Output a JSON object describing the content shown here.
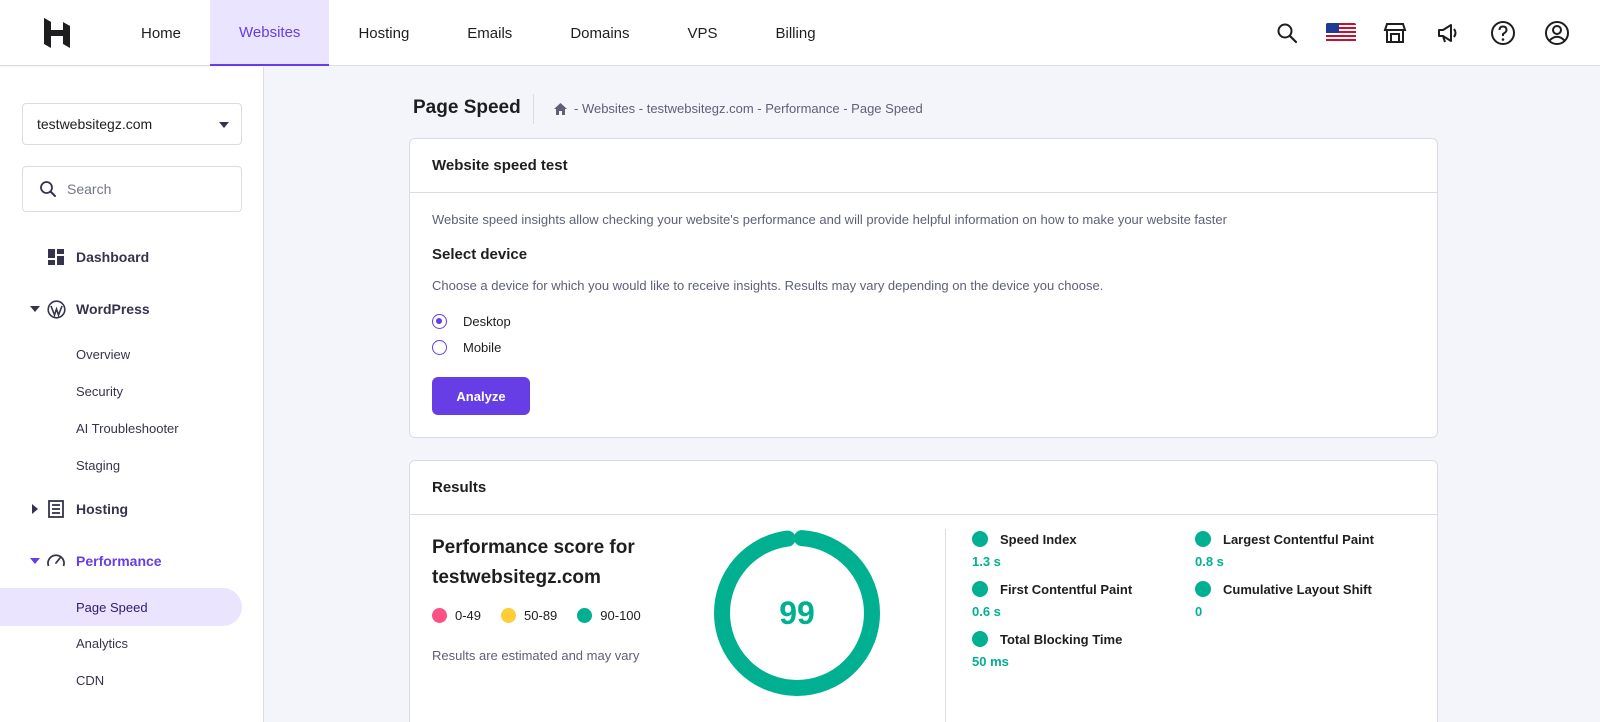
{
  "topnav": {
    "tabs": [
      {
        "label": "Home"
      },
      {
        "label": "Websites"
      },
      {
        "label": "Hosting"
      },
      {
        "label": "Emails"
      },
      {
        "label": "Domains"
      },
      {
        "label": "VPS"
      },
      {
        "label": "Billing"
      }
    ],
    "active_tab": "Websites",
    "icons": [
      "search-icon",
      "us-flag-icon",
      "store-icon",
      "megaphone-icon",
      "help-icon",
      "account-icon"
    ]
  },
  "sidebar": {
    "website_select": "testwebsitegz.com",
    "search_placeholder": "Search",
    "items": {
      "dashboard": "Dashboard",
      "wordpress": "WordPress",
      "overview": "Overview",
      "security": "Security",
      "ai_troubleshooter": "AI Troubleshooter",
      "staging": "Staging",
      "hosting": "Hosting",
      "performance": "Performance",
      "page_speed": "Page Speed",
      "analytics": "Analytics",
      "cdn": "CDN"
    }
  },
  "header": {
    "title": "Page Speed",
    "breadcrumb": "- Websites - testwebsitegz.com - Performance - Page Speed"
  },
  "speed_test": {
    "title": "Website speed test",
    "description": "Website speed insights allow checking your website's performance and will provide helpful information on how to make your website faster",
    "select_title": "Select device",
    "select_description": "Choose a device for which you would like to receive insights. Results may vary depending on the device you choose.",
    "options": [
      "Desktop",
      "Mobile"
    ],
    "selected": "Desktop",
    "button": "Analyze"
  },
  "results": {
    "title": "Results",
    "score_heading_line1": "Performance score for",
    "score_heading_line2": "testwebsitegz.com",
    "legend": [
      {
        "label": "0-49",
        "color": "#fc5185"
      },
      {
        "label": "50-89",
        "color": "#ffcd35"
      },
      {
        "label": "90-100",
        "color": "#00b090"
      }
    ],
    "note": "Results are estimated and may vary",
    "score": "99",
    "score_value": 99,
    "score_color": "#00b090",
    "metrics": [
      {
        "label": "Speed Index",
        "value": "1.3 s"
      },
      {
        "label": "Largest Contentful Paint",
        "value": "0.8 s"
      },
      {
        "label": "First Contentful Paint",
        "value": "0.6 s"
      },
      {
        "label": "Cumulative Layout Shift",
        "value": "0"
      },
      {
        "label": "Total Blocking Time",
        "value": "50 ms"
      }
    ]
  },
  "colors": {
    "accent": "#673de6",
    "good": "#00b090"
  }
}
